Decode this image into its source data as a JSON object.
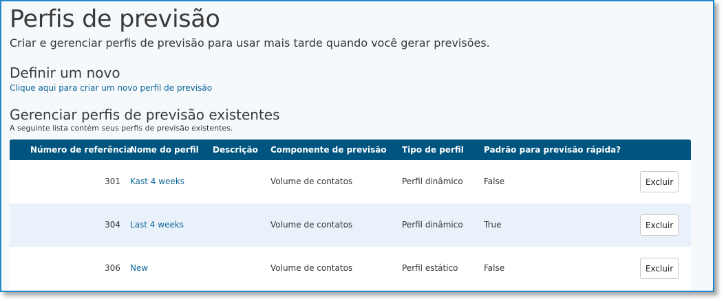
{
  "page": {
    "title": "Perfis de previsão",
    "subtitle": "Criar e gerenciar perfis de previsão para usar mais tarde quando você gerar previsões."
  },
  "define": {
    "title": "Definir um novo",
    "link": "Clique aqui para criar um novo perfil de previsão"
  },
  "manage": {
    "title": "Gerenciar perfis de previsão existentes",
    "description": "A seguinte lista contém seus perfis de previsão existentes."
  },
  "table": {
    "columns": {
      "ref": "Número de referência",
      "name": "Nome do perfil",
      "description": "Descrição",
      "component": "Componente de previsão",
      "type": "Tipo de perfil",
      "default": "Padrão para previsão rápida?"
    },
    "rows": [
      {
        "ref": "301",
        "name": "Kast 4 weeks",
        "description": "",
        "component": "Volume de contatos",
        "type": "Perfil dinâmico",
        "default": "False",
        "action": "Excluir"
      },
      {
        "ref": "304",
        "name": "Last 4 weeks",
        "description": "",
        "component": "Volume de contatos",
        "type": "Perfil dinâmico",
        "default": "True",
        "action": "Excluir"
      },
      {
        "ref": "306",
        "name": "New",
        "description": "",
        "component": "Volume de contatos",
        "type": "Perfil estático",
        "default": "False",
        "action": "Excluir"
      }
    ]
  },
  "colors": {
    "border": "#1e88c8",
    "header": "#005580",
    "link": "#0e6597",
    "row_alt": "#e9f2fa"
  }
}
